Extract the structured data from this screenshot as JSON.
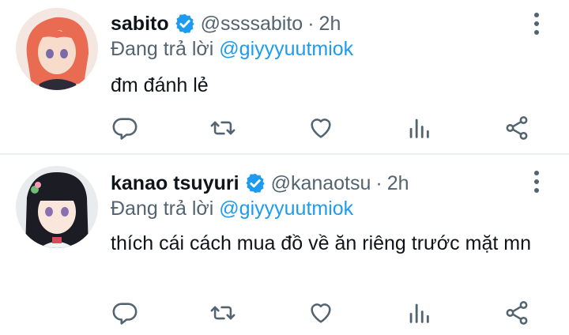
{
  "tweets": [
    {
      "name": "sabito",
      "handle": "@ssssabito",
      "separator": "·",
      "time": "2h",
      "reply_prefix": "Đang trả lời",
      "reply_to": "@giyyyuutmiok",
      "text": "đm đánh lẻ",
      "avatar_colors": {
        "bg": "#f4e6e0",
        "hair": "#e86b52",
        "skin": "#f7dccb",
        "clothes": "#2d2a3a"
      }
    },
    {
      "name": "kanao tsuyuri",
      "handle": "@kanaotsu",
      "separator": "·",
      "time": "2h",
      "reply_prefix": "Đang trả lời",
      "reply_to": "@giyyyuutmiok",
      "text": "thích cái cách mua đồ về ăn riêng trước mặt mn",
      "avatar_colors": {
        "bg": "#e9ecef",
        "hair": "#1c1c24",
        "skin": "#fbe6dc",
        "clothes": "#f2f2f2"
      }
    }
  ],
  "icons": [
    "reply-icon",
    "retweet-icon",
    "like-icon",
    "stats-icon",
    "share-icon",
    "more-icon",
    "verified-icon"
  ],
  "colors": {
    "accent": "#1d9bf0",
    "text": "#0f1419",
    "secondary": "#536471"
  }
}
